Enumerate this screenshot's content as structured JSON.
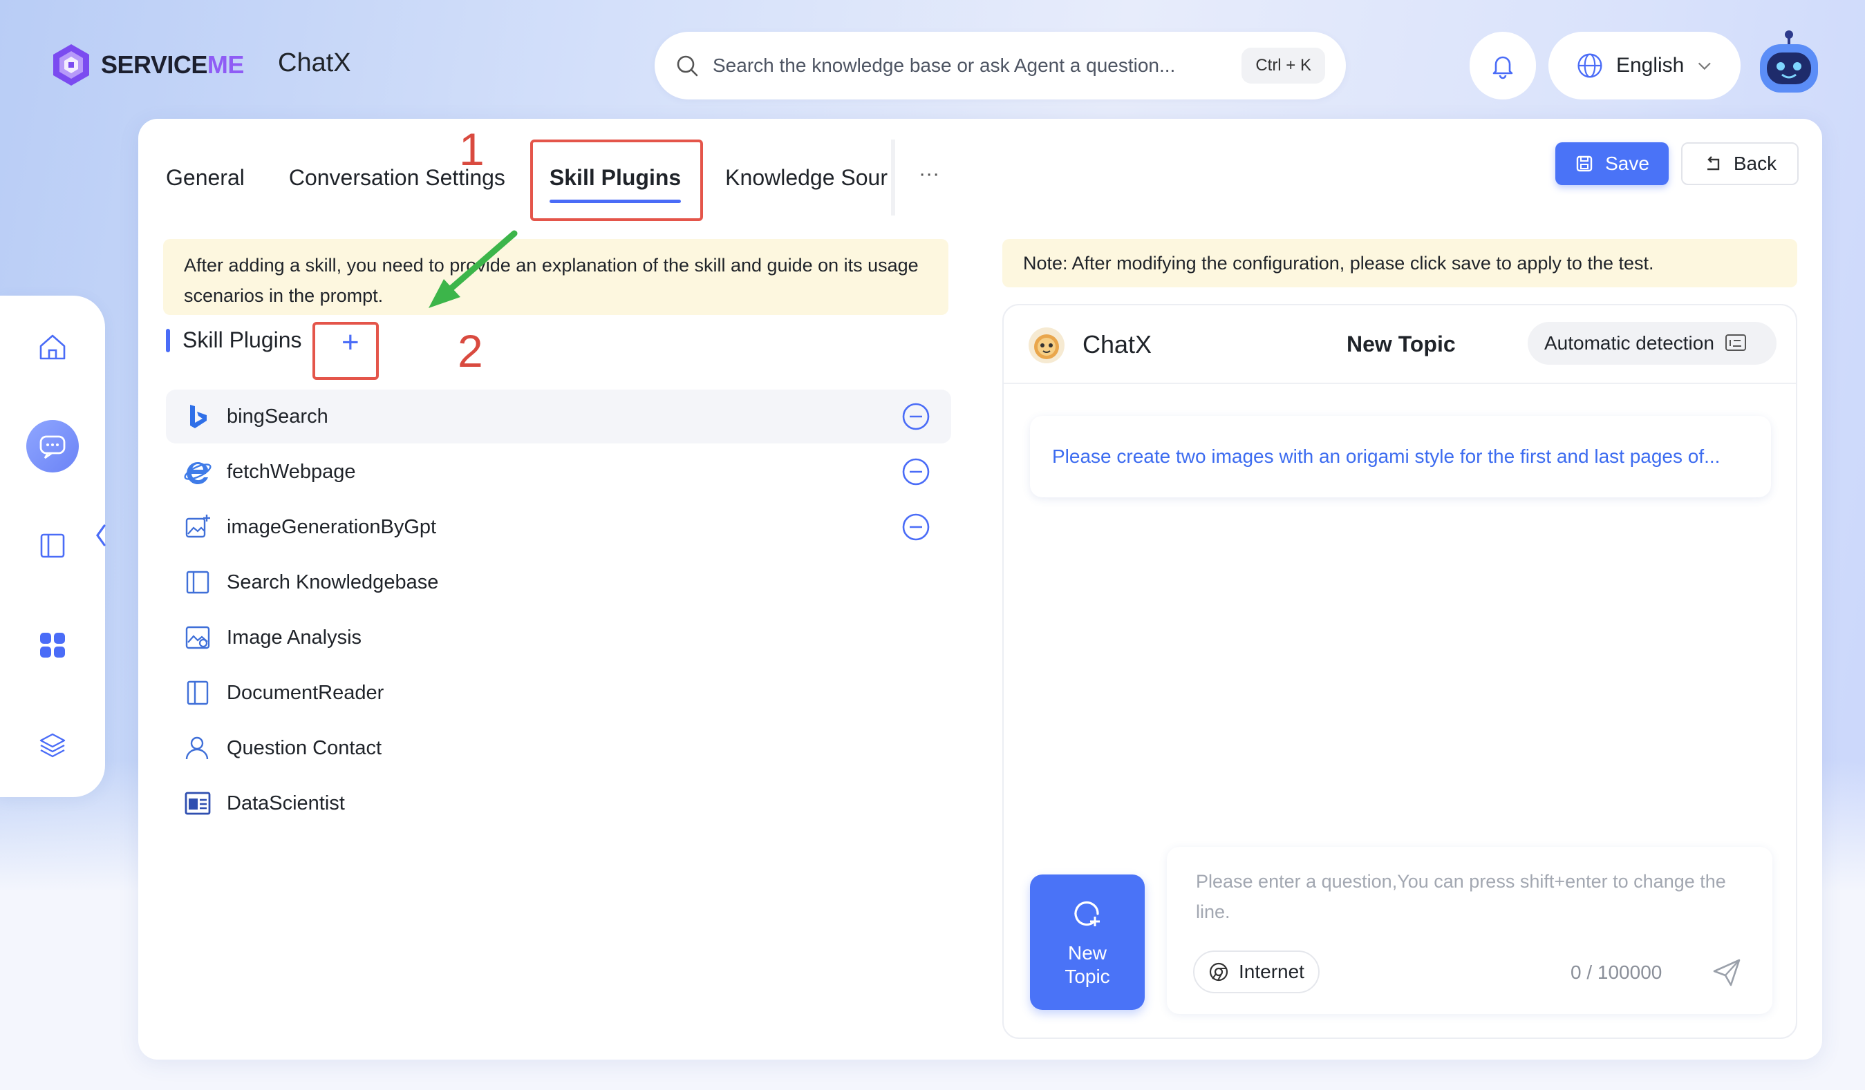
{
  "header": {
    "logo_prefix": "SERVICE",
    "logo_suffix": "ME",
    "app_name": "ChatX",
    "search_placeholder": "Search the knowledge base or ask Agent a question...",
    "search_shortcut": "Ctrl + K",
    "language": "English"
  },
  "tabs": [
    {
      "label": "General"
    },
    {
      "label": "Conversation Settings"
    },
    {
      "label": "Skill Plugins"
    },
    {
      "label": "Knowledge Sources"
    }
  ],
  "tabs_more": "···",
  "actions": {
    "save": "Save",
    "back": "Back"
  },
  "hints": {
    "left": "After adding a skill, you need to provide an explanation of the skill and guide on its usage scenarios in the prompt.",
    "right": "Note: After modifying the configuration, please click save to apply to the test."
  },
  "section": {
    "title": "Skill Plugins",
    "add": "+"
  },
  "annotations": {
    "step1": "1",
    "step2": "2"
  },
  "skills": [
    {
      "name": "bingSearch",
      "icon": "bing-icon",
      "removable": true
    },
    {
      "name": "fetchWebpage",
      "icon": "ie-icon",
      "removable": true
    },
    {
      "name": "imageGenerationByGpt",
      "icon": "image-plus-icon",
      "removable": true
    },
    {
      "name": "Search Knowledgebase",
      "icon": "book-icon",
      "removable": false
    },
    {
      "name": "Image Analysis",
      "icon": "image-search-icon",
      "removable": false
    },
    {
      "name": "DocumentReader",
      "icon": "document-icon",
      "removable": false
    },
    {
      "name": "Question Contact",
      "icon": "user-icon",
      "removable": false
    },
    {
      "name": "DataScientist",
      "icon": "data-icon",
      "removable": false
    }
  ],
  "chat": {
    "brand": "ChatX",
    "topic": "New Topic",
    "detect_label": "Automatic detection",
    "prompt": "Please create two images with an origami style for the first and last pages of...",
    "new_topic_line1": "New",
    "new_topic_line2": "Topic",
    "input_placeholder": "Please enter a question,You can press shift+enter to change the line.",
    "internet_label": "Internet",
    "counter": "0 / 100000"
  },
  "colors": {
    "accent": "#4a73f7",
    "annotation": "#e4554a",
    "hint_bg": "#fdf7df",
    "arrow": "#3cb54a"
  }
}
